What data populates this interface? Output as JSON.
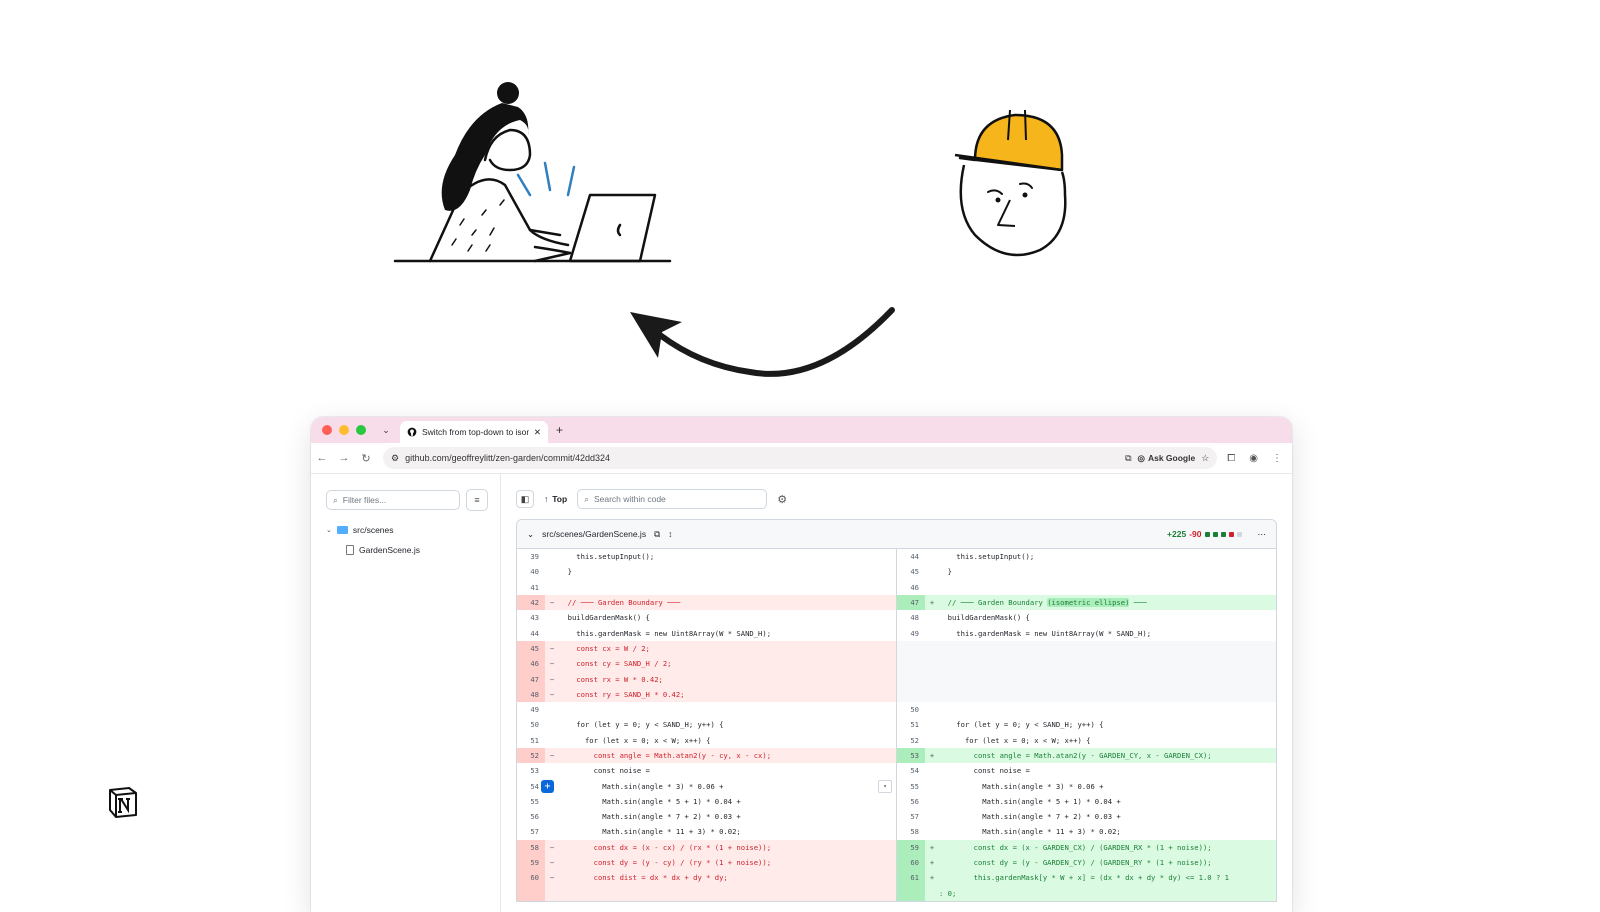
{
  "illustrations": {
    "woman": "woman-typing-on-laptop",
    "worker": "construction-worker-face-icon",
    "arrow": "curved-arrow-left",
    "logo": "notion-logo"
  },
  "browser": {
    "tab_title": "Switch from top-down to isom",
    "url": "github.com/geoffreylitt/zen-garden/commit/42dd324",
    "ask_google": "Ask Google",
    "colors": {
      "close": "#ff5f57",
      "minimize": "#febc2e",
      "maximize": "#28c840",
      "tabstrip": "#f7dde9"
    }
  },
  "files": {
    "filter_placeholder": "Filter files...",
    "folder": "src/scenes",
    "file": "GardenScene.js"
  },
  "diffbar": {
    "top_label": "Top",
    "search_placeholder": "Search within code"
  },
  "diff": {
    "path": "src/scenes/GardenScene.js",
    "additions": "+225",
    "deletions": "-90",
    "left": [
      {
        "n": "39",
        "t": "ctx",
        "c": "    this.setupInput();"
      },
      {
        "n": "40",
        "t": "ctx",
        "c": "  }"
      },
      {
        "n": "41",
        "t": "ctx",
        "c": ""
      },
      {
        "n": "42",
        "t": "del",
        "m": "−",
        "c": "  // ─── Garden Boundary ───"
      },
      {
        "n": "43",
        "t": "ctx",
        "c": "  buildGardenMask() {"
      },
      {
        "n": "44",
        "t": "ctx",
        "c": "    this.gardenMask = new Uint8Array(W * SAND_H);"
      },
      {
        "n": "45",
        "t": "del",
        "m": "−",
        "c": "    const cx = W / 2;"
      },
      {
        "n": "46",
        "t": "del",
        "m": "−",
        "c": "    const cy = SAND_H / 2;"
      },
      {
        "n": "47",
        "t": "del",
        "m": "−",
        "c": "    const rx = W * 0.42;"
      },
      {
        "n": "48",
        "t": "del",
        "m": "−",
        "c": "    const ry = SAND_H * 0.42;"
      },
      {
        "n": "49",
        "t": "ctx",
        "c": ""
      },
      {
        "n": "50",
        "t": "ctx",
        "c": "    for (let y = 0; y < SAND_H; y++) {"
      },
      {
        "n": "51",
        "t": "ctx",
        "c": "      for (let x = 0; x < W; x++) {"
      },
      {
        "n": "52",
        "t": "del",
        "m": "−",
        "c": "        const angle = Math.atan2(y - cy, x - cx);"
      },
      {
        "n": "53",
        "t": "ctx",
        "c": "        const noise ="
      },
      {
        "n": "54",
        "t": "ctx",
        "c": "          Math.sin(angle * 3) * 0.06 +"
      },
      {
        "n": "55",
        "t": "ctx",
        "c": "          Math.sin(angle * 5 + 1) * 0.04 +"
      },
      {
        "n": "56",
        "t": "ctx",
        "c": "          Math.sin(angle * 7 + 2) * 0.03 +"
      },
      {
        "n": "57",
        "t": "ctx",
        "c": "          Math.sin(angle * 11 + 3) * 0.02;"
      },
      {
        "n": "58",
        "t": "del",
        "m": "−",
        "c": "        const dx = (x - cx) / (rx * (1 + noise));"
      },
      {
        "n": "59",
        "t": "del",
        "m": "−",
        "c": "        const dy = (y - cy) / (ry * (1 + noise));"
      },
      {
        "n": "60",
        "t": "del",
        "m": "−",
        "c": "        const dist = dx * dx + dy * dy;"
      },
      {
        "n": "",
        "t": "del",
        "m": "",
        "c": ""
      }
    ],
    "right": [
      {
        "n": "44",
        "t": "ctx",
        "c": "    this.setupInput();"
      },
      {
        "n": "45",
        "t": "ctx",
        "c": "  }"
      },
      {
        "n": "46",
        "t": "ctx",
        "c": ""
      },
      {
        "n": "47",
        "t": "add",
        "m": "+",
        "c": "  // ─── Garden Boundary ",
        "h": "(isometric ellipse)",
        "c2": " ───"
      },
      {
        "n": "48",
        "t": "ctx",
        "c": "  buildGardenMask() {"
      },
      {
        "n": "49",
        "t": "ctx",
        "c": "    this.gardenMask = new Uint8Array(W * SAND_H);"
      },
      {
        "n": "",
        "t": "empty",
        "c": ""
      },
      {
        "n": "",
        "t": "empty",
        "c": ""
      },
      {
        "n": "",
        "t": "empty",
        "c": ""
      },
      {
        "n": "",
        "t": "empty",
        "c": ""
      },
      {
        "n": "50",
        "t": "ctx",
        "c": ""
      },
      {
        "n": "51",
        "t": "ctx",
        "c": "    for (let y = 0; y < SAND_H; y++) {"
      },
      {
        "n": "52",
        "t": "ctx",
        "c": "      for (let x = 0; x < W; x++) {"
      },
      {
        "n": "53",
        "t": "add",
        "m": "+",
        "c": "        const angle = Math.atan2(y - GARDEN_CY, x - GARDEN_CX);"
      },
      {
        "n": "54",
        "t": "ctx",
        "c": "        const noise ="
      },
      {
        "n": "55",
        "t": "ctx",
        "c": "          Math.sin(angle * 3) * 0.06 +"
      },
      {
        "n": "56",
        "t": "ctx",
        "c": "          Math.sin(angle * 5 + 1) * 0.04 +"
      },
      {
        "n": "57",
        "t": "ctx",
        "c": "          Math.sin(angle * 7 + 2) * 0.03 +"
      },
      {
        "n": "58",
        "t": "ctx",
        "c": "          Math.sin(angle * 11 + 3) * 0.02;"
      },
      {
        "n": "59",
        "t": "add",
        "m": "+",
        "c": "        const dx = (x - GARDEN_CX) / (GARDEN_RX * (1 + noise));"
      },
      {
        "n": "60",
        "t": "add",
        "m": "+",
        "c": "        const dy = (y - GARDEN_CY) / (GARDEN_RY * (1 + noise));"
      },
      {
        "n": "61",
        "t": "add",
        "m": "+",
        "c": "        this.gardenMask[y * W + x] = (dx * dx + dy * dy) <= 1.0 ? 1"
      },
      {
        "n": "",
        "t": "add",
        "m": "",
        "c": ": 0;"
      }
    ]
  }
}
